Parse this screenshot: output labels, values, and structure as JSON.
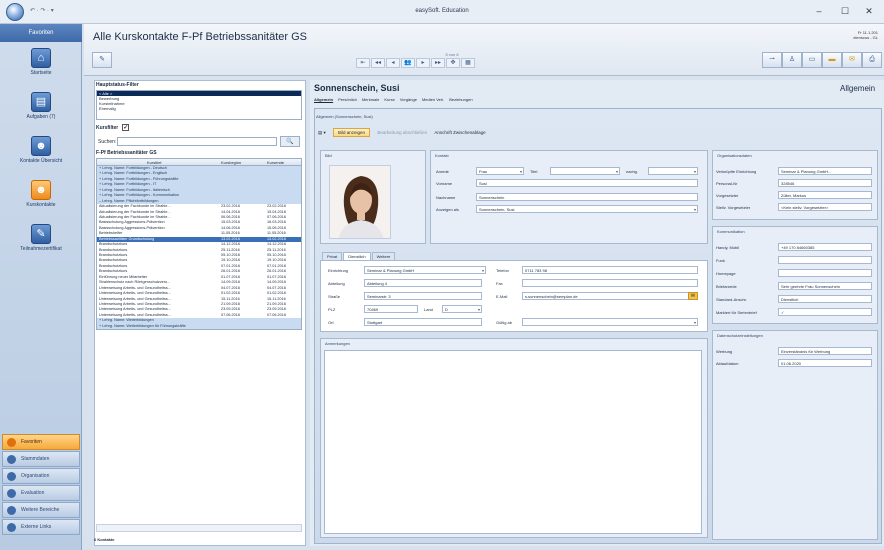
{
  "window": {
    "title": "easySoft. Education",
    "quick_access": "↶ · ↷ · ▾",
    "btn_min": "–",
    "btn_max": "☐",
    "btn_close": "✕"
  },
  "favorites": {
    "header": "Favoriten",
    "items": [
      {
        "label": "Startseite",
        "icon": "home-icon",
        "glyph": "⌂"
      },
      {
        "label": "Aufgaben (7)",
        "icon": "clipboard-icon",
        "glyph": "▤"
      },
      {
        "label": "Kontakte Übersicht",
        "icon": "person-icon",
        "glyph": "☻"
      },
      {
        "label": "Kurskontakte",
        "icon": "person-orange-icon",
        "glyph": "☻"
      },
      {
        "label": "Teilnahmezertifikat",
        "icon": "certificate-icon",
        "glyph": "✎"
      }
    ]
  },
  "nav": [
    {
      "label": "Favoriten",
      "active": true
    },
    {
      "label": "Stammdaten"
    },
    {
      "label": "Organisation"
    },
    {
      "label": "Evaluation"
    },
    {
      "label": "Weitere Bereiche"
    },
    {
      "label": "Externe Links"
    }
  ],
  "page": {
    "title": "Alle Kurskontakte F-Pf Betriebssanitäter GS",
    "stamp_line1": "Fr 11.1.201",
    "stamp_line2": "elenscus - GL"
  },
  "record_nav": {
    "position": "5 von 6",
    "buttons": [
      "⇤",
      "◂◂",
      "◂",
      "👥",
      "▸",
      "▸▸",
      "✥",
      "▦"
    ]
  },
  "filter": {
    "title": "Hauptstatus-Filter",
    "rows": [
      "< Alle >",
      "Bewerbung",
      "Kursteilnahme",
      "Ehemalig"
    ],
    "kurfilter_label": "Kursfilter",
    "kurfilter_check": "✓",
    "search_label": "Suchen:",
    "search_icon": "🔍",
    "group_title": "F-Pf Betriebssanitäter GS",
    "columns": [
      "Kurstitel",
      "Kursbeginn",
      "Kursende"
    ],
    "footer": "6 Kontakte",
    "rows_grid": [
      {
        "t": "+ Lehrg. Name: Fortbildungen - Deutsch",
        "g": true
      },
      {
        "t": "+ Lehrg. Name: Fortbildungen - Englisch",
        "g": true
      },
      {
        "t": "+ Lehrg. Name: Fortbildungen - Führungskräfte",
        "g": true
      },
      {
        "t": "+ Lehrg. Name: Fortbildungen - IT",
        "g": true
      },
      {
        "t": "+ Lehrg. Name: Fortbildungen - Italienisch",
        "g": true
      },
      {
        "t": "+ Lehrg. Name: Fortbildungen - Kommunikation",
        "g": true
      },
      {
        "t": "– Lehrg. Name: Pflichtfortbildungen",
        "g": true
      },
      {
        "t": "Aktualisierung der Fachkunde im Strahle...",
        "b": "23.02.2016",
        "e": "23.02.2016"
      },
      {
        "t": "Aktualisierung der Fachkunde im Strahle...",
        "b": "14.04.2016",
        "e": "15.04.2016"
      },
      {
        "t": "Aktualisierung der Fachkunde im Strahle...",
        "b": "06.06.2016",
        "e": "07.06.2016"
      },
      {
        "t": "Basisschulung Aggressions-Prävention",
        "b": "15.03.2016",
        "e": "16.03.2016"
      },
      {
        "t": "Basisschulung Aggressions-Prävention",
        "b": "14.06.2016",
        "e": "15.06.2016"
      },
      {
        "t": "Betriebshelfer",
        "b": "11.05.2016",
        "e": "11.05.2016"
      },
      {
        "t": "Betriebssanitäter Grundschulung",
        "b": "13.02.2016",
        "e": "13.02.2016",
        "s": true
      },
      {
        "t": "Brandschutzkurs",
        "b": "14.12.2016",
        "e": "14.12.2016"
      },
      {
        "t": "Brandschutzkurs",
        "b": "25.11.2016",
        "e": "25.11.2016"
      },
      {
        "t": "Brandschutzkurs",
        "b": "05.10.2016",
        "e": "05.10.2016"
      },
      {
        "t": "Brandschutzkurs",
        "b": "19.10.2016",
        "e": "19.10.2016"
      },
      {
        "t": "Brandschutzkurs",
        "b": "07.01.2016",
        "e": "07.01.2016"
      },
      {
        "t": "Brandschutzkurs",
        "b": "26.01.2016",
        "e": "26.01.2016"
      },
      {
        "t": "Einführung neuer Mitarbeiter",
        "b": "01.07.2016",
        "e": "01.07.2016"
      },
      {
        "t": "Strahlenschutz nach Röntgenschutzvero...",
        "b": "14.09.2016",
        "e": "14.09.2016"
      },
      {
        "t": "Unterweisung Arbeits- und Gesundheitss...",
        "b": "04.07.2016",
        "e": "04.07.2016"
      },
      {
        "t": "Unterweisung Arbeits- und Gesundheitss...",
        "b": "01.02.2016",
        "e": "01.02.2016"
      },
      {
        "t": "Unterweisung Arbeits- und Gesundheitss...",
        "b": "15.11.2016",
        "e": "15.11.2016"
      },
      {
        "t": "Unterweisung Arbeits- und Gesundheitss...",
        "b": "21.09.2016",
        "e": "21.09.2016"
      },
      {
        "t": "Unterweisung Arbeits- und Gesundheitss...",
        "b": "23.09.2016",
        "e": "23.09.2016"
      },
      {
        "t": "Unterweisung Arbeits- und Gesundheitss...",
        "b": "07.06.2016",
        "e": "07.06.2016"
      },
      {
        "t": "+ Lehrg. Name: Weiterbildungen",
        "g": true
      },
      {
        "t": "+ Lehrg. Name: Weiterbildungen für Führungskräfte",
        "g": true
      }
    ]
  },
  "detail": {
    "name": "Sonnenschein, Susi",
    "right_title": "Allgemein",
    "tabs": [
      "Allgemein",
      "Persönlich",
      "Merkmale",
      "Kurse",
      "Vorgänge",
      "Medien Verl.",
      "Beziehungen"
    ],
    "inner_title": "Allgemein (Sonnenschein, Susi)",
    "toolbar": {
      "bild": "Bild anzeigen",
      "bild_bearbeiten": "Bearbeitung abschließen",
      "anschrift": "Anschrift Zwischenablage"
    },
    "bild_label": "Bild",
    "kontakt": {
      "title": "Kontakt",
      "anrede_l": "Anrede",
      "anrede": "Frau",
      "titel_l": "Titel",
      "titel": "",
      "nachg_l": "nachg.",
      "nachg": "",
      "vorname_l": "Vorname",
      "vorname": "Susi",
      "nachname_l": "Nachname",
      "nachname": "Sonnenschein",
      "anzeigen_l": "Anzeigen als",
      "anzeigen": "Sonnenschein, Susi"
    },
    "subtabs": [
      "Privat",
      "Dienstlich",
      "Weitere"
    ],
    "dienst": {
      "einrichtung_l": "Einrichtung",
      "einrichtung": "Seminar & Planung GmbH",
      "abteilung_l": "Abteilung",
      "abteilung": "Abteilung 4",
      "strasse_l": "Straße",
      "strasse": "Seminarstr. 3",
      "plz_l": "PLZ",
      "plz": "70469",
      "land_l": "Land",
      "land": "D",
      "ort_l": "Ort",
      "ort": "Stuttgart",
      "telefon_l": "Telefon",
      "telefon": "0711 783 98",
      "fax_l": "Fax",
      "fax": "",
      "email_l": "E-Mail",
      "email": "s.sonnenschein@semplan.de",
      "gueltig_l": "Gültig ab",
      "gueltig": ""
    },
    "anmerkungen": "Anmerkungen",
    "orgdaten": {
      "title": "Organisationsdaten",
      "rows": [
        {
          "l": "Verknüpfte Einrichtung",
          "v": "Seminar & Planung GmbH..."
        },
        {
          "l": "Personal-Nr",
          "v": "328546"
        },
        {
          "l": "Vorgesetzter",
          "v": "Züller, Markus"
        },
        {
          "l": "Stellv. Vorgesetzter",
          "v": "<Kein stellv. Vorgesetzter>"
        }
      ]
    },
    "kommunikation": {
      "title": "Kommunikation",
      "rows": [
        {
          "l": "Handy, Mobil",
          "v": "+49 170 84660385"
        },
        {
          "l": "Funk",
          "v": ""
        },
        {
          "l": "Homepage",
          "v": ""
        },
        {
          "l": "Briefanrede",
          "v": "Sehr geehrte Frau Sonnenschein"
        },
        {
          "l": "Standard-Anschr.",
          "v": "Dienstlich"
        },
        {
          "l": "Markiert für Serienbrief",
          "v": "✓"
        }
      ]
    },
    "datenschutz": {
      "title": "Datenschutzeinstellungen",
      "rows": [
        {
          "l": "Werbung",
          "v": "Einverständnis für Werbung"
        },
        {
          "l": "Ablaufdatum",
          "v": "01.06.2020"
        }
      ]
    }
  }
}
